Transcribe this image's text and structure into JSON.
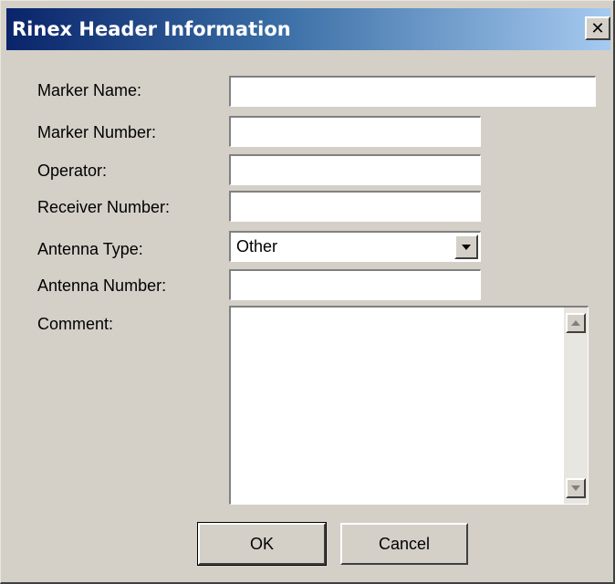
{
  "window": {
    "title": "Rinex Header Information",
    "close_glyph": "✕"
  },
  "form": {
    "marker_name": {
      "label": "Marker Name:",
      "value": ""
    },
    "marker_number": {
      "label": "Marker Number:",
      "value": ""
    },
    "operator": {
      "label": "Operator:",
      "value": ""
    },
    "receiver_number": {
      "label": "Receiver Number:",
      "value": ""
    },
    "antenna_type": {
      "label": "Antenna Type:",
      "value": "Other"
    },
    "antenna_number": {
      "label": "Antenna Number:",
      "value": ""
    },
    "comment": {
      "label": "Comment:",
      "value": ""
    }
  },
  "buttons": {
    "ok_label": "OK",
    "cancel_label": "Cancel"
  },
  "colors": {
    "title_gradient_start": "#0a246a",
    "title_gradient_end": "#a6caf0",
    "dialog_face": "#d4d0c8"
  }
}
